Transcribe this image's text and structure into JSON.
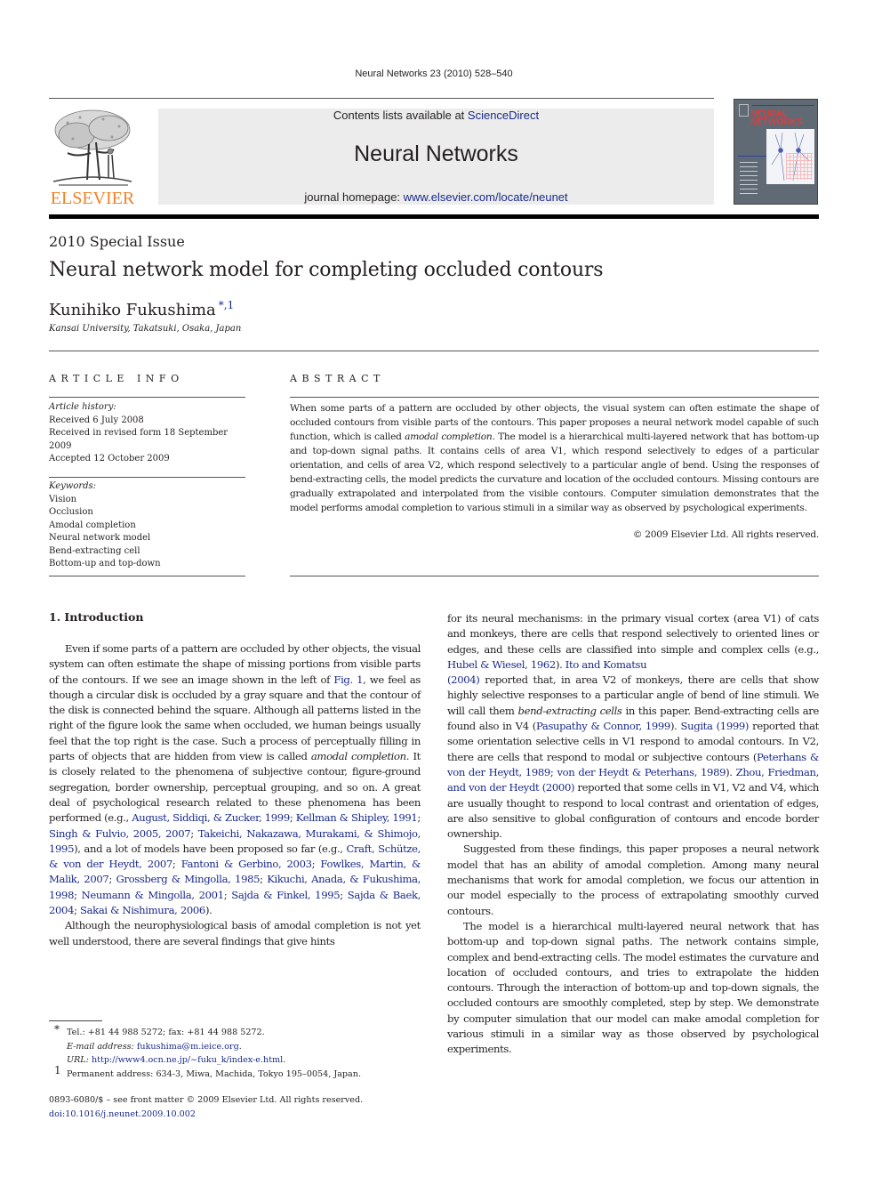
{
  "running_head": "Neural Networks 23 (2010) 528–540",
  "masthead": {
    "publisher_logo_text": "ELSEVIER",
    "publisher_logo_icon": "elsevier-tree-icon",
    "contents_prefix": "Contents lists available at ",
    "contents_link": "ScienceDirect",
    "journal_name": "Neural Networks",
    "homepage_prefix": "journal homepage: ",
    "homepage_link": "www.elsevier.com/locate/neunet",
    "cover_title_line1": "NEURAL",
    "cover_title_line2": "NETWORKS",
    "colors": {
      "logo_orange": "#f08224",
      "link_blue": "#1a2a8a",
      "header_gray": "#ececec",
      "cover_slate": "#5f6a74"
    }
  },
  "article": {
    "special_issue": "2010 Special Issue",
    "title": "Neural network model for completing occluded contours",
    "author": "Kunihiko Fukushima",
    "author_marks": "*,1",
    "affiliation": "Kansai University, Takatsuki, Osaka, Japan"
  },
  "article_info": {
    "heading": "ARTICLE INFO",
    "history_label": "Article history:",
    "history": [
      "Received 6 July 2008",
      "Received in revised form 18 September 2009",
      "Accepted 12 October 2009"
    ],
    "keywords_label": "Keywords:",
    "keywords": [
      "Vision",
      "Occlusion",
      "Amodal completion",
      "Neural network model",
      "Bend-extracting cell",
      "Bottom-up and top-down"
    ]
  },
  "abstract": {
    "heading": "ABSTRACT",
    "text_1": "When some parts of a pattern are occluded by other objects, the visual system can often estimate the shape of occluded contours from visible parts of the contours. This paper proposes a neural network model capable of such function, which is called ",
    "text_italic": "amodal completion",
    "text_2": ". The model is a hierarchical multi-layered network that has bottom-up and top-down signal paths. It contains cells of area V1, which respond selectively to edges of a particular orientation, and cells of area V2, which respond selectively to a particular angle of bend. Using the responses of bend-extracting cells, the model predicts the curvature and location of the occluded contours. Missing contours are gradually extrapolated and interpolated from the visible contours. Computer simulation demonstrates that the model performs amodal completion to various stimuli in a similar way as observed by psychological experiments.",
    "copyright": "© 2009 Elsevier Ltd. All rights reserved."
  },
  "intro": {
    "heading": "1.  Introduction",
    "p1": {
      "a": "Even if some parts of a pattern are occluded by other objects, the visual system can often estimate the shape of missing portions from visible parts of the contours. If we see an image shown in the left of ",
      "fig_link": "Fig. 1",
      "b": ", we feel as though a circular disk is occluded by a gray square and that the contour of the disk is connected behind the square. Although all patterns listed in the right of the figure look the same when occluded, we human beings usually feel that the top right is the case. Such a process of perceptually filling in parts of objects that are hidden from view is called ",
      "italic": "amodal completion",
      "c": ". It is closely related to the phenomena of subjective contour, figure-ground segregation, border ownership, perceptual grouping, and so on. A great deal of psychological research related to these phenomena has been performed (e.g., ",
      "refs1": [
        "August, Siddiqi, & Zucker, 1999",
        "Kellman & Shipley, 1991",
        "Singh & Fulvio, 2005, 2007",
        "Takeichi, Nakazawa, Murakami, & Shimojo, 1995"
      ],
      "d": "), and a lot of models have been proposed so far (e.g., ",
      "refs2": [
        "Craft, Schütze, & von der Heydt, 2007",
        "Fantoni & Gerbino, 2003",
        "Fowlkes, Martin, & Malik, 2007",
        "Grossberg & Mingolla, 1985",
        "Kikuchi, Anada, & Fukushima, 1998",
        "Neumann & Mingolla, 2001",
        "Sajda & Finkel, 1995",
        "Sajda & Baek, 2004",
        "Sakai & Nishimura, 2006"
      ],
      "e": ")."
    },
    "p2_left": "Although the neurophysiological basis of amodal completion is not yet well understood, there are several findings that give hints",
    "p2_right": {
      "a": "for its neural mechanisms: in the primary visual cortex (area V1) of cats and monkeys, there are cells that respond selectively to oriented lines or edges, and these cells are classified into simple and complex cells (e.g., ",
      "ref_hubel": "Hubel & Wiesel, 1962",
      "b": "). ",
      "ref_ito": "Ito and Komatsu",
      "ref_ito_year": "(2004)",
      "c": " reported that, in area V2 of monkeys, there are cells that show highly selective responses to a particular angle of bend of line stimuli. We will call them ",
      "italic": "bend-extracting cells",
      "d": " in this paper. Bend-extracting cells are found also in V4 (",
      "ref_pasupathy": "Pasupathy & Connor, 1999",
      "e": "). ",
      "ref_sugita": "Sugita",
      "ref_sugita_year": "(1999)",
      "f": " reported that some orientation selective cells in V1 respond to amodal contours. In V2, there are cells that respond to modal or subjective contours (",
      "ref_peterhans": "Peterhans & von der Heydt, 1989",
      "g": "; ",
      "ref_vonder": "von der Heydt & Peterhans, 1989",
      "h": "). ",
      "ref_zhou": "Zhou, Friedman, and von der Heydt",
      "ref_zhou_year": "(2000)",
      "i": " reported that some cells in V1, V2 and V4, which are usually thought to respond to local contrast and orientation of edges, are also sensitive to global configuration of contours and encode border ownership."
    },
    "p3": "Suggested from these findings, this paper proposes a neural network model that has an ability of amodal completion. Among many neural mechanisms that work for amodal completion, we focus our attention in our model especially to the process of extrapolating smoothly curved contours.",
    "p4": "The model is a hierarchical multi-layered neural network that has bottom-up and top-down signal paths. The network contains simple, complex and bend-extracting cells. The model estimates the curvature and location of occluded contours, and tries to extrapolate the hidden contours. Through the interaction of bottom-up and top-down signals, the occluded contours are smoothly completed, step by step. We demonstrate by computer simulation that our model can make amodal completion for various stimuli in a similar way as those observed by psychological experiments."
  },
  "footnotes": {
    "star_mark": "*",
    "tel": "Tel.: +81 44 988 5272; fax: +81 44 988 5272.",
    "email_label": "E-mail address:",
    "email": "fukushima@m.ieice.org",
    "url_label": "URL:",
    "url": "http://www4.ocn.ne.jp/~fuku_k/index-e.html",
    "one_mark": "1",
    "permanent": "Permanent address: 634-3, Miwa, Machida, Tokyo 195–0054, Japan."
  },
  "front_matter": {
    "issn_line": "0893-6080/$ – see front matter © 2009 Elsevier Ltd. All rights reserved.",
    "doi": "doi:10.1016/j.neunet.2009.10.002"
  }
}
